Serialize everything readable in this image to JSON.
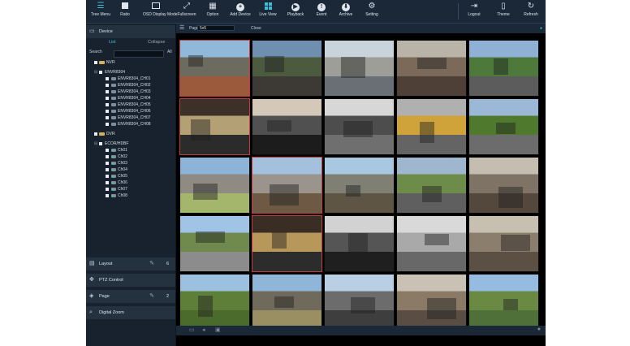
{
  "toolbar": {
    "items": [
      {
        "label": "Tree Menu",
        "icon": "tree-menu-icon"
      },
      {
        "label": "Ratio",
        "icon": "ratio-icon"
      },
      {
        "label": "OSD Display Mode",
        "icon": "osd-display-icon"
      },
      {
        "label": "Fullscreen",
        "icon": "fullscreen-icon"
      },
      {
        "label": "Option",
        "icon": "option-icon"
      },
      {
        "label": "Add Device",
        "icon": "add-device-icon"
      },
      {
        "label": "Live View",
        "icon": "live-view-icon"
      },
      {
        "label": "Playback",
        "icon": "playback-icon"
      },
      {
        "label": "Event",
        "icon": "event-icon"
      },
      {
        "label": "Archive",
        "icon": "archive-icon"
      },
      {
        "label": "Setting",
        "icon": "setting-icon"
      },
      {
        "label": "Logout",
        "icon": "logout-icon"
      },
      {
        "label": "Theme",
        "icon": "theme-icon"
      },
      {
        "label": "Refresh",
        "icon": "refresh-icon"
      }
    ],
    "accent": "#39c0d8"
  },
  "sidebar": {
    "device_title": "Device",
    "tab_list": "List",
    "tab_collapse": "Collapse",
    "search_label": "Search",
    "search_value": "",
    "search_all": "All",
    "nvr": {
      "group": "NVR",
      "device": "ENVR8304",
      "channels": [
        "ENVR8304_CH01",
        "ENVR8304_CH02",
        "ENVR8304_CH03",
        "ENVR8304_CH04",
        "ENVR8304_CH05",
        "ENVR8304_CH06",
        "ENVR8304_CH07",
        "ENVR8304_CH08"
      ]
    },
    "dvr": {
      "group": "DVR",
      "device": "ECOR/HDBF",
      "channels": [
        "Ch01",
        "Ch02",
        "Ch03",
        "Ch04",
        "Ch05",
        "Ch06",
        "Ch07",
        "Ch08"
      ]
    },
    "sections": {
      "layout_label": "Layout",
      "layout_count": "6",
      "ptz_label": "PTZ Control",
      "page_label": "Page",
      "page_count": "2",
      "zoom_label": "Digital Zoom"
    }
  },
  "main": {
    "page_label": "Page",
    "page_value": "5x5",
    "close_label": "Close"
  }
}
